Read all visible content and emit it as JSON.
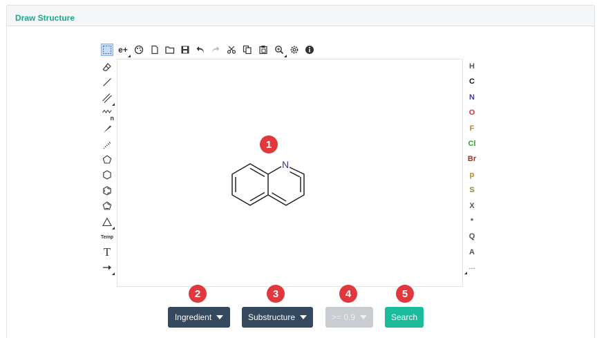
{
  "panel": {
    "title": "Draw Structure"
  },
  "toolbar_top": [
    {
      "name": "rectangle-select-icon",
      "selected": true
    },
    {
      "name": "charge-plus-icon",
      "label": "e+"
    },
    {
      "name": "palette-icon"
    },
    {
      "name": "new-file-icon"
    },
    {
      "name": "open-folder-icon"
    },
    {
      "name": "save-icon"
    },
    {
      "name": "undo-icon"
    },
    {
      "name": "redo-icon",
      "disabled": true
    },
    {
      "name": "cut-icon"
    },
    {
      "name": "copy-icon"
    },
    {
      "name": "paste-icon"
    },
    {
      "name": "zoom-icon"
    },
    {
      "name": "settings-icon"
    },
    {
      "name": "info-icon"
    }
  ],
  "toolbar_left": [
    {
      "name": "eraser-icon"
    },
    {
      "name": "single-bond-icon"
    },
    {
      "name": "double-bond-icon"
    },
    {
      "name": "chain-icon",
      "label": "n"
    },
    {
      "name": "wedge-bond-icon"
    },
    {
      "name": "hash-bond-icon"
    },
    {
      "name": "pentagon-ring-icon"
    },
    {
      "name": "hexagon-ring-icon"
    },
    {
      "name": "benzene-ring-icon"
    },
    {
      "name": "cyclopentadiene-ring-icon"
    },
    {
      "name": "triangle-ring-icon"
    },
    {
      "name": "template-icon",
      "label": "Temp"
    },
    {
      "name": "text-tool-icon",
      "label": "T"
    },
    {
      "name": "arrow-tool-icon"
    }
  ],
  "atoms": [
    {
      "symbol": "H",
      "color": "#555555"
    },
    {
      "symbol": "C",
      "color": "#111111"
    },
    {
      "symbol": "N",
      "color": "#3b3ba3"
    },
    {
      "symbol": "O",
      "color": "#e03030"
    },
    {
      "symbol": "F",
      "color": "#b8862b"
    },
    {
      "symbol": "Cl",
      "color": "#30a030"
    },
    {
      "symbol": "Br",
      "color": "#8b3a2a"
    },
    {
      "symbol": "p",
      "color": "#c08020"
    },
    {
      "symbol": "S",
      "color": "#8a8a2a"
    },
    {
      "symbol": "X",
      "color": "#555555"
    },
    {
      "symbol": "*",
      "color": "#555555"
    },
    {
      "symbol": "Q",
      "color": "#555555"
    },
    {
      "symbol": "A",
      "color": "#555555"
    }
  ],
  "atoms_more": "...",
  "molecule": {
    "heteroatom": "N",
    "heteroatom_color": "#2c3e8c"
  },
  "badges": [
    "1",
    "2",
    "3",
    "4",
    "5"
  ],
  "buttons": {
    "ingredient": "Ingredient",
    "substructure": "Substructure",
    "similarity": ">= 0.9",
    "search": "Search"
  },
  "colors": {
    "accent": "#1ba98e",
    "dark_button": "#34495e",
    "search_button": "#1abc9c",
    "badge": "#e0383c"
  }
}
